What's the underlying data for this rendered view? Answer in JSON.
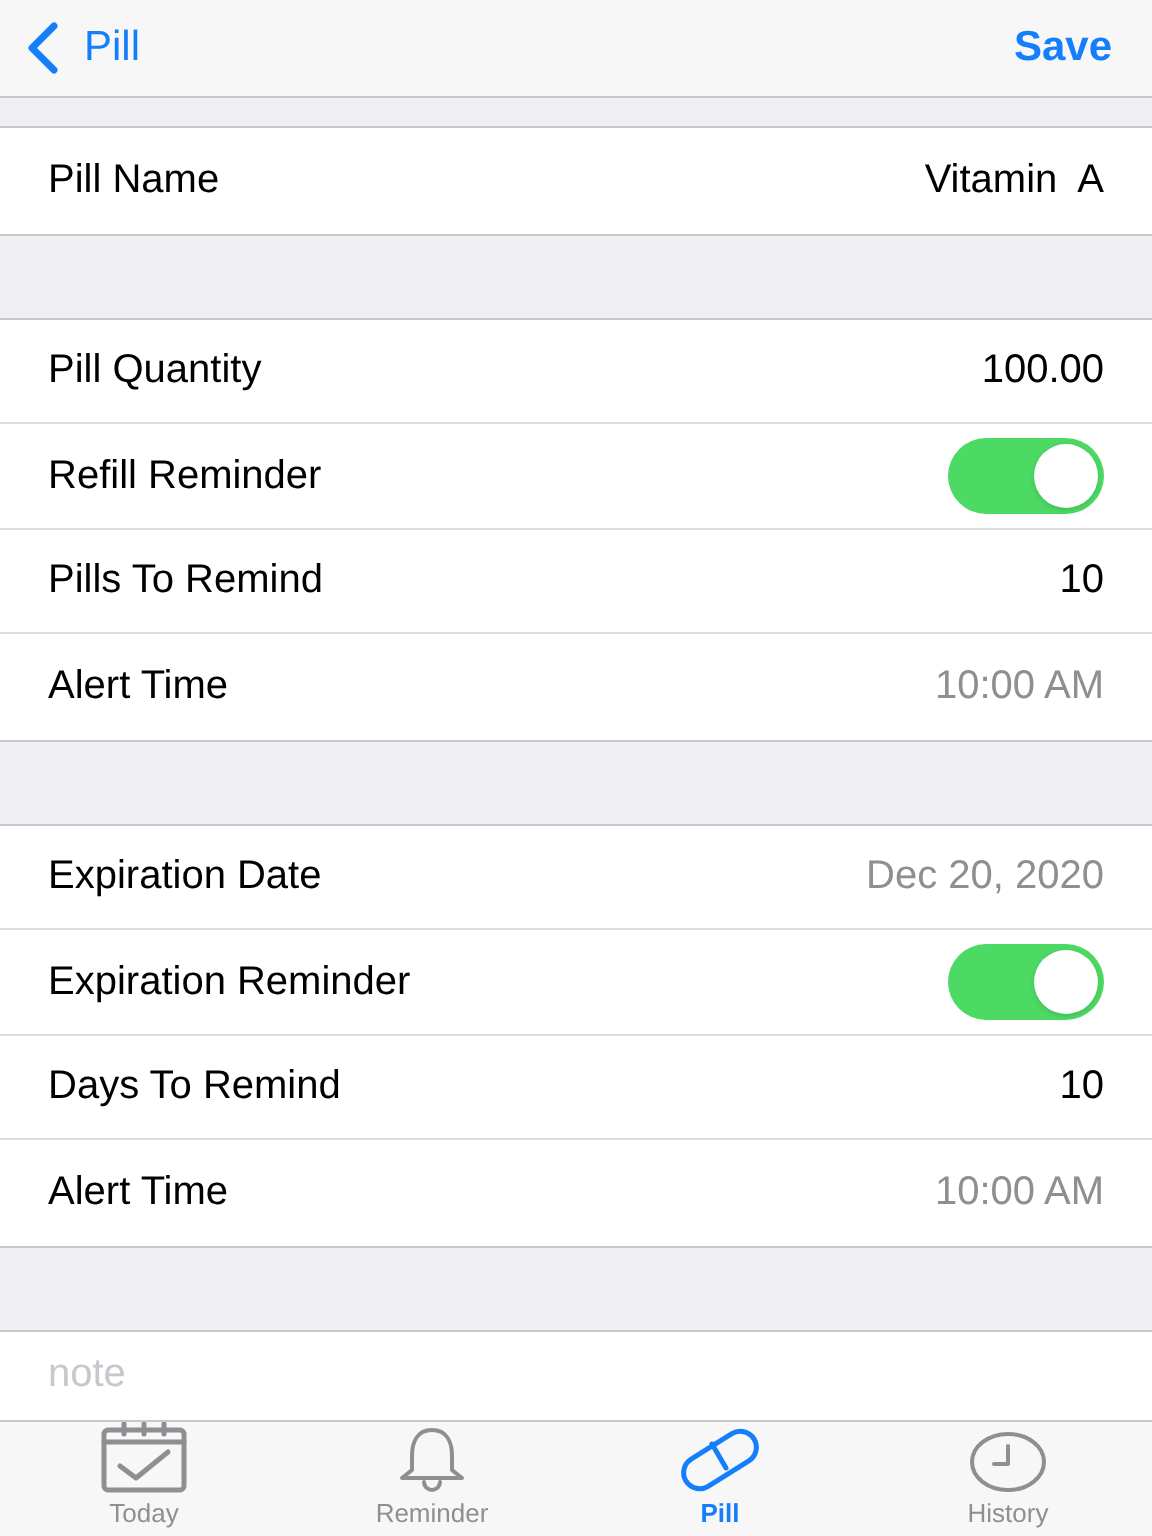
{
  "nav": {
    "back_label": "Pill",
    "action": "Save"
  },
  "sections": [
    {
      "rows": [
        {
          "kind": "value",
          "label": "Pill Name",
          "value": "Vitamin  A"
        }
      ]
    },
    {
      "rows": [
        {
          "kind": "value",
          "label": "Pill Quantity",
          "value": "100.00"
        },
        {
          "kind": "toggle",
          "label": "Refill Reminder",
          "on": true
        },
        {
          "kind": "value",
          "label": "Pills To Remind",
          "value": "10"
        },
        {
          "kind": "picker",
          "label": "Alert Time",
          "value": "10:00 AM"
        }
      ]
    },
    {
      "rows": [
        {
          "kind": "picker",
          "label": "Expiration Date",
          "value": "Dec 20, 2020"
        },
        {
          "kind": "toggle",
          "label": "Expiration Reminder",
          "on": true
        },
        {
          "kind": "value",
          "label": "Days To Remind",
          "value": "10"
        },
        {
          "kind": "picker",
          "label": "Alert Time",
          "value": "10:00 AM"
        }
      ]
    }
  ],
  "note": {
    "placeholder": "note"
  },
  "tabs": [
    {
      "kind": "calendar",
      "label": "Today",
      "selected": false
    },
    {
      "kind": "bell",
      "label": "Reminder",
      "selected": false
    },
    {
      "kind": "pill",
      "label": "Pill",
      "selected": true
    },
    {
      "kind": "clock",
      "label": "History",
      "selected": false
    }
  ]
}
